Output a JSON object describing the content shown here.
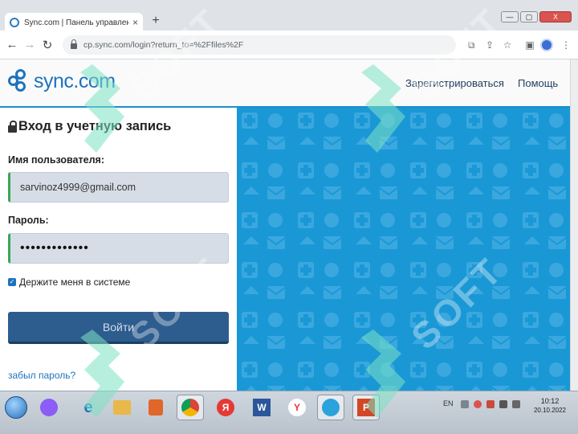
{
  "browser": {
    "tab_title": "Sync.com | Панель управления",
    "tab_close": "×",
    "new_tab": "+",
    "tab_menu": "⌄",
    "window_min": "—",
    "window_max": "▢",
    "window_close": "X",
    "url": "cp.sync.com/login?return_to=%2Ffiles%2F",
    "back": "←",
    "forward": "→",
    "reload": "↻"
  },
  "header": {
    "logo_text": "sync.com",
    "signup_link": "Зарегистрироваться",
    "help_link": "Помощь"
  },
  "login": {
    "title": "Вход в учетную запись",
    "username_label": "Имя пользователя:",
    "username_value": "sarvinoz4999@gmail.com",
    "password_label": "Пароль:",
    "password_value": "•••••••••••••",
    "remember_label": "Держите меня в системе",
    "remember_checked": true,
    "submit_label": "Войти",
    "forgot_link": "забыл пароль?"
  },
  "taskbar": {
    "apps": [
      {
        "name": "alice",
        "label": ""
      },
      {
        "name": "internet-explorer",
        "label": "e"
      },
      {
        "name": "file-manager",
        "label": ""
      },
      {
        "name": "media",
        "label": ""
      },
      {
        "name": "chrome",
        "label": ""
      },
      {
        "name": "yandex",
        "label": "Я"
      },
      {
        "name": "word",
        "label": "W"
      },
      {
        "name": "yandex-browser",
        "label": "Y"
      },
      {
        "name": "telegram",
        "label": ""
      },
      {
        "name": "powerpoint",
        "label": "P"
      }
    ],
    "lang": "EN",
    "time": "10:12",
    "date": "20.10.2022"
  },
  "watermark": {
    "text": "SOFT"
  },
  "colors": {
    "brand": "#1e73be",
    "promo_bg": "#1a98d6",
    "button": "#2d5c8e",
    "field_accent": "#3aa655"
  }
}
